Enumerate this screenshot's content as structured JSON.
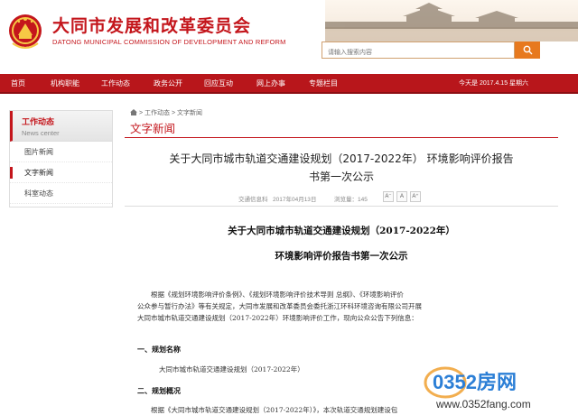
{
  "header": {
    "title": "大同市发展和改革委员会",
    "subtitle": "DATONG MUNICIPAL COMMISSION OF DEVELOPMENT AND REFORM",
    "search_placeholder": "请输入搜索内容"
  },
  "nav": {
    "items": [
      "首页",
      "机构职能",
      "工作动态",
      "政务公开",
      "网上办事",
      "回应互动",
      "专题栏目"
    ],
    "date": "今天是  2017.4.15  星期六"
  },
  "sidebar": {
    "title": "工作动态",
    "subtitle": "News center",
    "items": [
      "图片新闻",
      "文字新闻",
      "科室动态"
    ],
    "active_index": 1
  },
  "breadcrumb": {
    "items": [
      "工作动态",
      "文字新闻"
    ],
    "separator": ">"
  },
  "section_title": "文字新闻",
  "article": {
    "title_line1": "关于大同市城市轨道交通建设规划（2017-2022年）  环境影响评价报告",
    "title_line2": "书第一次公示",
    "meta": {
      "source": "交通信息科",
      "date": "2017年04月13日",
      "views": "浏览量：145",
      "font_buttons": [
        "A⁻",
        "A",
        "A⁺"
      ]
    },
    "doc_title_line1": "关于大同市城市轨道交通建设规划（2017-2022年）",
    "doc_title_line2": "环境影响评价报告书第一次公示",
    "para1_line1": "根据《规划环境影响评价条例》、《规划环境影响评价技术导则 总纲》、《环境影响评价",
    "para1_line2": "公众参与暂行办法》等有关规定，大同市发展和改革委员会委托浙江环科环境咨询有限公司开展",
    "para1_line3": "大同市城市轨道交通建设规划（2017-2022年）环境影响评价工作，现向公众公告下列信息：",
    "heading1": "一、规划名称",
    "plan_name": "大同市城市轨道交通建设规划（2017-2022年）",
    "heading2": "二、规划概况",
    "para2_line1": "根据《大同市城市轨道交通建设规划（2017-2022年）》，本次轨道交通规划建设包"
  },
  "watermark": {
    "brand": "0352房网",
    "url": "www.0352fang.com"
  },
  "colors": {
    "brand_red": "#c4161c",
    "nav_red": "#b8161b",
    "search_orange": "#e7791e"
  }
}
